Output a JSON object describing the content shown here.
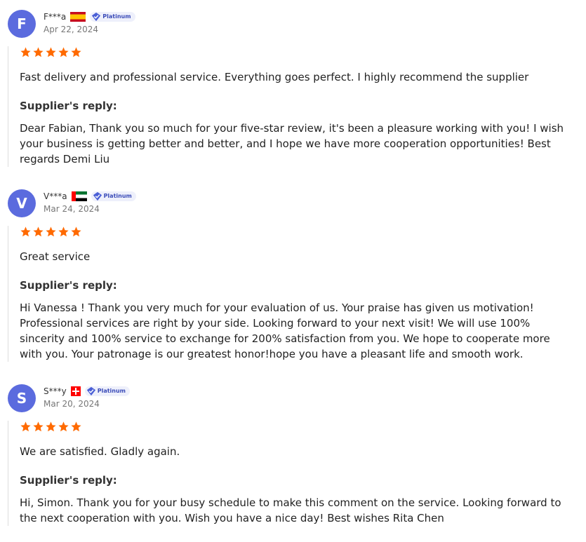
{
  "colors": {
    "star": "#ff6a00",
    "avatar_bg": "#5b6bde",
    "badge_text": "#3a4bb8"
  },
  "reviews": [
    {
      "initial": "F",
      "name": "F***a",
      "flag": "spain-flag-icon",
      "badge": "Platinum",
      "date": "Apr 22, 2024",
      "rating": 5,
      "text": "Fast delivery and professional service. Everything goes perfect. I highly recommend the supplier",
      "reply_label": "Supplier's reply:",
      "reply": "Dear Fabian, Thank you so much for your five-star review, it's been a pleasure working with you! I wish your business is getting better and better, and I hope we have more cooperation opportunities! Best regards Demi Liu"
    },
    {
      "initial": "V",
      "name": "V***a",
      "flag": "uae-flag-icon",
      "badge": "Platinum",
      "date": "Mar 24, 2024",
      "rating": 5,
      "text": "Great service",
      "reply_label": "Supplier's reply:",
      "reply": "Hi Vanessa !  Thank you very much for your evaluation of us. Your praise has given us motivation! Professional services are right by your side. Looking forward to your next visit! We will use 100% sincerity and 100% service to exchange for 200% satisfaction from you. We hope to cooperate more with you. Your patronage is our greatest honor!hope you have a pleasant life and smooth work."
    },
    {
      "initial": "S",
      "name": "S***y",
      "flag": "switzerland-flag-icon",
      "badge": "Platinum",
      "date": "Mar 20, 2024",
      "rating": 5,
      "text": "We are satisfied. Gladly again.",
      "reply_label": "Supplier's reply:",
      "reply": "Hi, Simon. Thank you for your busy schedule to make this comment on the service. Looking forward to the next cooperation with you. Wish you have a nice day! Best wishes Rita Chen"
    }
  ]
}
